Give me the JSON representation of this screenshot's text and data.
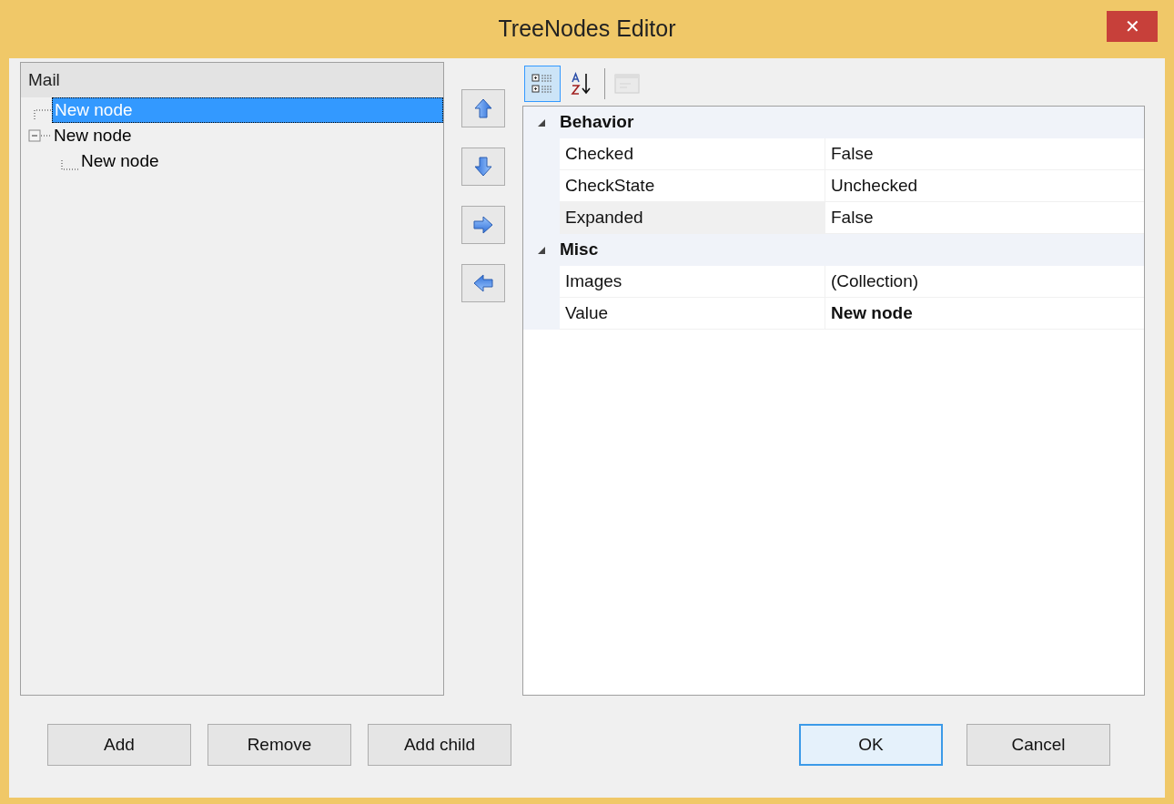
{
  "window": {
    "title": "TreeNodes Editor",
    "close": "✕"
  },
  "tree": {
    "header": "Mail",
    "nodes": [
      {
        "label": "New node",
        "selected": true
      },
      {
        "label": "New node",
        "selected": false,
        "expanded": true,
        "children": [
          {
            "label": "New node",
            "selected": false
          }
        ]
      }
    ]
  },
  "move_buttons": [
    {
      "kind": "up"
    },
    {
      "kind": "down"
    },
    {
      "kind": "right"
    },
    {
      "kind": "left"
    }
  ],
  "toolbar": [
    {
      "kind": "categorized",
      "selected": true,
      "disabled": false
    },
    {
      "kind": "alphabetical",
      "selected": false,
      "disabled": false
    },
    {
      "kind": "pages",
      "selected": false,
      "disabled": true
    }
  ],
  "properties": [
    {
      "category": "Behavior",
      "expanded": true,
      "rows": [
        {
          "name": "Checked",
          "value": "False",
          "modified": false,
          "selected": false
        },
        {
          "name": "CheckState",
          "value": "Unchecked",
          "modified": false,
          "selected": false
        },
        {
          "name": "Expanded",
          "value": "False",
          "modified": false,
          "selected": true
        }
      ]
    },
    {
      "category": "Misc",
      "expanded": true,
      "rows": [
        {
          "name": "Images",
          "value": "(Collection)",
          "modified": false,
          "selected": false
        },
        {
          "name": "Value",
          "value": "New node",
          "modified": true,
          "selected": false
        }
      ]
    }
  ],
  "buttons_left": [
    "Add",
    "Remove",
    "Add child"
  ],
  "buttons_right": [
    {
      "label": "OK",
      "default": true
    },
    {
      "label": "Cancel",
      "default": false
    }
  ]
}
